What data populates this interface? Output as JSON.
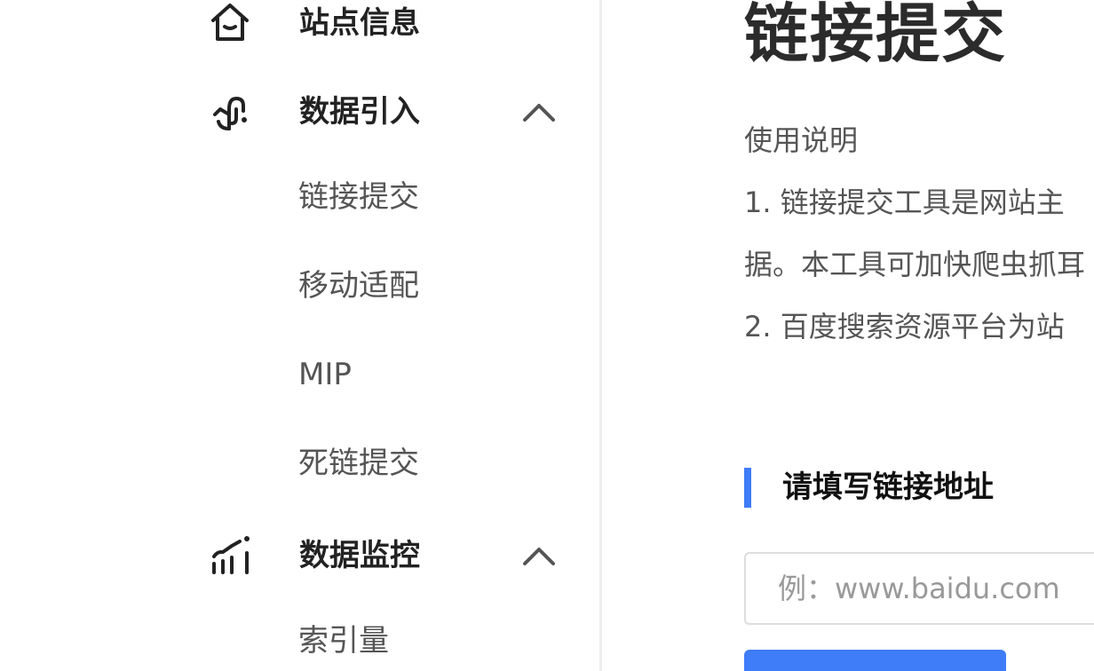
{
  "sidebar": {
    "groups": {
      "site_info": {
        "label": "站点信息",
        "icon": "home-icon"
      },
      "data_import": {
        "label": "数据引入",
        "icon": "link-hook-icon",
        "expanded": true,
        "items": [
          {
            "label": "链接提交",
            "active": true
          },
          {
            "label": "移动适配"
          },
          {
            "label": "MIP"
          },
          {
            "label": "死链提交"
          }
        ]
      },
      "data_monitor": {
        "label": "数据监控",
        "icon": "bar-chart-icon",
        "expanded": true,
        "items": [
          {
            "label": "索引量"
          }
        ]
      }
    }
  },
  "main": {
    "title": "链接提交",
    "usage_heading": "使用说明",
    "lines": [
      "1. 链接提交工具是网站主",
      "据。本工具可加快爬虫抓耳",
      "2. 百度搜索资源平台为站"
    ],
    "section_title": "请填写链接地址",
    "url_input": {
      "placeholder": "例：www.baidu.com",
      "value": ""
    }
  },
  "colors": {
    "accent": "#3f7cf7",
    "text_primary": "#222222",
    "text_secondary": "#555555",
    "border": "#dddddd"
  }
}
